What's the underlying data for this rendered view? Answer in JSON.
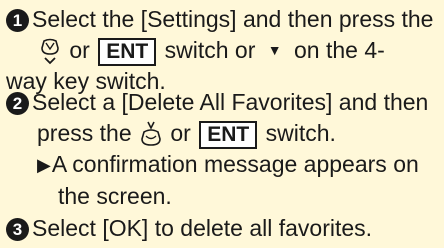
{
  "steps": [
    {
      "number": "1",
      "line1": "Select the [Settings] and then press the",
      "line2_or": "or",
      "key": "ENT",
      "line2_mid": "switch or",
      "line2_end": "on the 4-",
      "line3": "way key switch.",
      "icons": [
        "dial-down-icon",
        "down-triangle-icon"
      ]
    },
    {
      "number": "2",
      "line1": "Select a [Delete All Favorites] and then",
      "line2_pre": "press the",
      "line2_or": "or",
      "key": "ENT",
      "line2_end": "switch.",
      "result_arrow": "▶",
      "result_line1": "A confirmation message appears on",
      "result_line2": "the screen.",
      "icons": [
        "dial-press-icon"
      ]
    },
    {
      "number": "3",
      "text": "Select [OK] to delete all favorites."
    }
  ]
}
